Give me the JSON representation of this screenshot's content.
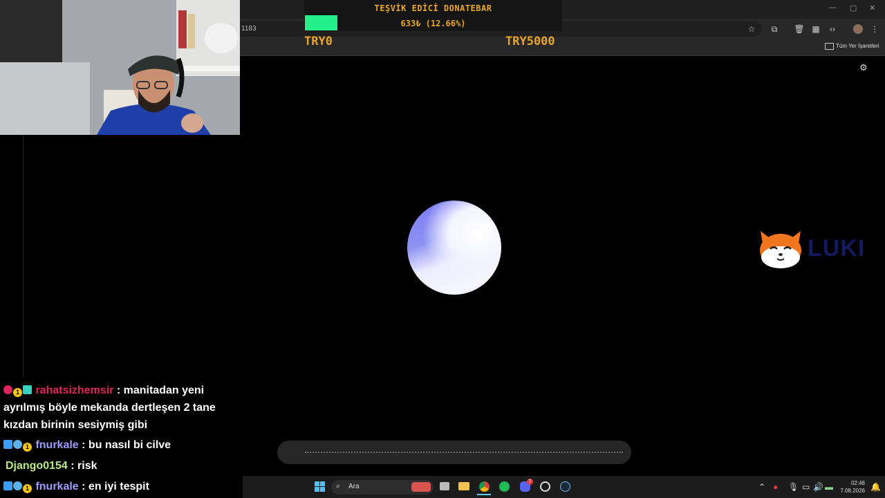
{
  "browser": {
    "url_fragment": "1183",
    "bookmarks_label": "Tüm Yer İşaretleri"
  },
  "donatebar": {
    "title": "TEŞVİK EDİCİ DONATEBAR",
    "amount": "633₺ (12.66%)",
    "min_label": "TRY0",
    "max_label": "TRY5000",
    "progress_percent": 12.66,
    "fill_color": "#23f08a",
    "text_color": "#e8a52a"
  },
  "logo": {
    "text": "LUKI"
  },
  "chat": [
    {
      "user": "rahatsizhemsir",
      "user_color": "#e0245e",
      "message": ": manitadan yeni",
      "message_line2": "ayrılmış böyle mekanda dertleşen 2 tane",
      "message_line3": "kızdan birinin sesiymiş gibi"
    },
    {
      "user": "fnurkale",
      "user_color": "#9d9dff",
      "message": ": bu nasıl bi cilve"
    },
    {
      "user": "Django0154",
      "user_color": "#b8e986",
      "message": ": risk"
    },
    {
      "user": "fnurkale",
      "user_color": "#9d9dff",
      "message": ": en iyi tespit"
    }
  ],
  "badges": {
    "subscriber_1": "1"
  },
  "taskbar": {
    "search_placeholder": "Ara",
    "clock_time": "02:48",
    "clock_date": "7.08.2026",
    "discord_badge": "7"
  }
}
